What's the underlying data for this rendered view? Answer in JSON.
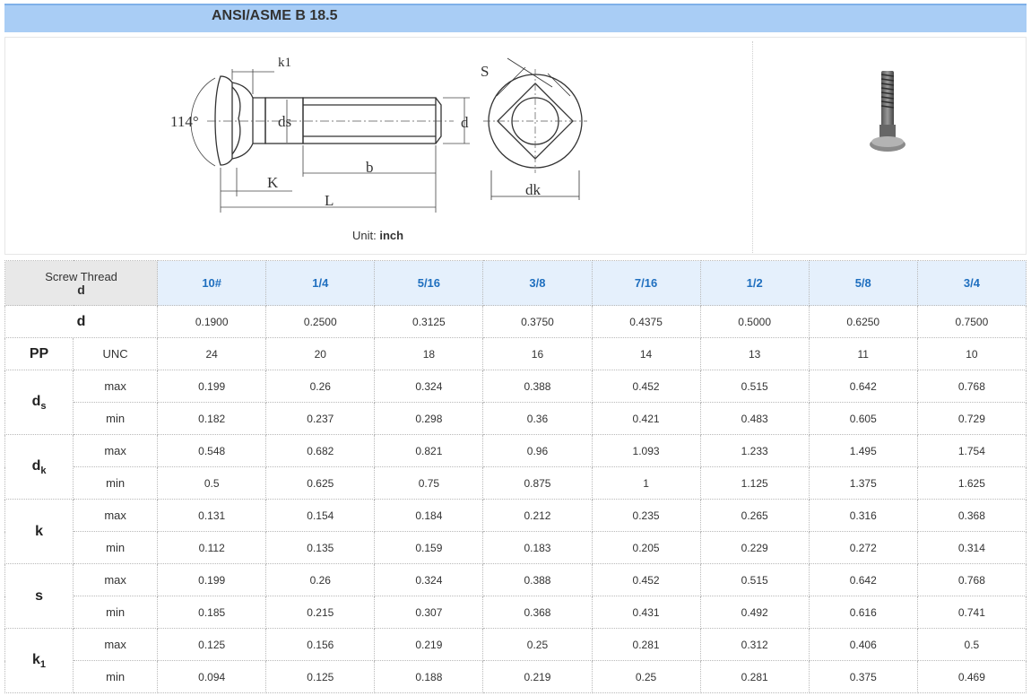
{
  "header": {
    "title": "ANSI/ASME B 18.5"
  },
  "figure": {
    "unit_label": "Unit:",
    "unit_value": "inch",
    "drawing_labels": {
      "angle": "114°",
      "k1": "k1",
      "ds": "ds",
      "K": "K",
      "b": "b",
      "L": "L",
      "d": "d",
      "S": "S",
      "dk": "dk"
    }
  },
  "table": {
    "corner_label": "Screw Thread",
    "corner_sub": "d",
    "sizes": [
      "10#",
      "1/4",
      "5/16",
      "3/8",
      "7/16",
      "1/2",
      "5/8",
      "3/4"
    ],
    "d_label": "d",
    "d_values": [
      "0.1900",
      "0.2500",
      "0.3125",
      "0.3750",
      "0.4375",
      "0.5000",
      "0.6250",
      "0.7500"
    ],
    "pp_label": "PP",
    "pp_sub": "UNC",
    "pp_values": [
      "24",
      "20",
      "18",
      "16",
      "14",
      "13",
      "11",
      "10"
    ],
    "max_label": "max",
    "min_label": "min",
    "ds": {
      "label": "d",
      "sub": "s",
      "max": [
        "0.199",
        "0.26",
        "0.324",
        "0.388",
        "0.452",
        "0.515",
        "0.642",
        "0.768"
      ],
      "min": [
        "0.182",
        "0.237",
        "0.298",
        "0.36",
        "0.421",
        "0.483",
        "0.605",
        "0.729"
      ]
    },
    "dk": {
      "label": "d",
      "sub": "k",
      "max": [
        "0.548",
        "0.682",
        "0.821",
        "0.96",
        "1.093",
        "1.233",
        "1.495",
        "1.754"
      ],
      "min": [
        "0.5",
        "0.625",
        "0.75",
        "0.875",
        "1",
        "1.125",
        "1.375",
        "1.625"
      ]
    },
    "k": {
      "label": "k",
      "max": [
        "0.131",
        "0.154",
        "0.184",
        "0.212",
        "0.235",
        "0.265",
        "0.316",
        "0.368"
      ],
      "min": [
        "0.112",
        "0.135",
        "0.159",
        "0.183",
        "0.205",
        "0.229",
        "0.272",
        "0.314"
      ]
    },
    "s": {
      "label": "s",
      "max": [
        "0.199",
        "0.26",
        "0.324",
        "0.388",
        "0.452",
        "0.515",
        "0.642",
        "0.768"
      ],
      "min": [
        "0.185",
        "0.215",
        "0.307",
        "0.368",
        "0.431",
        "0.492",
        "0.616",
        "0.741"
      ]
    },
    "k1": {
      "label": "k",
      "sub": "1",
      "max": [
        "0.125",
        "0.156",
        "0.219",
        "0.25",
        "0.281",
        "0.312",
        "0.406",
        "0.5"
      ],
      "min": [
        "0.094",
        "0.125",
        "0.188",
        "0.219",
        "0.25",
        "0.281",
        "0.375",
        "0.469"
      ]
    }
  }
}
